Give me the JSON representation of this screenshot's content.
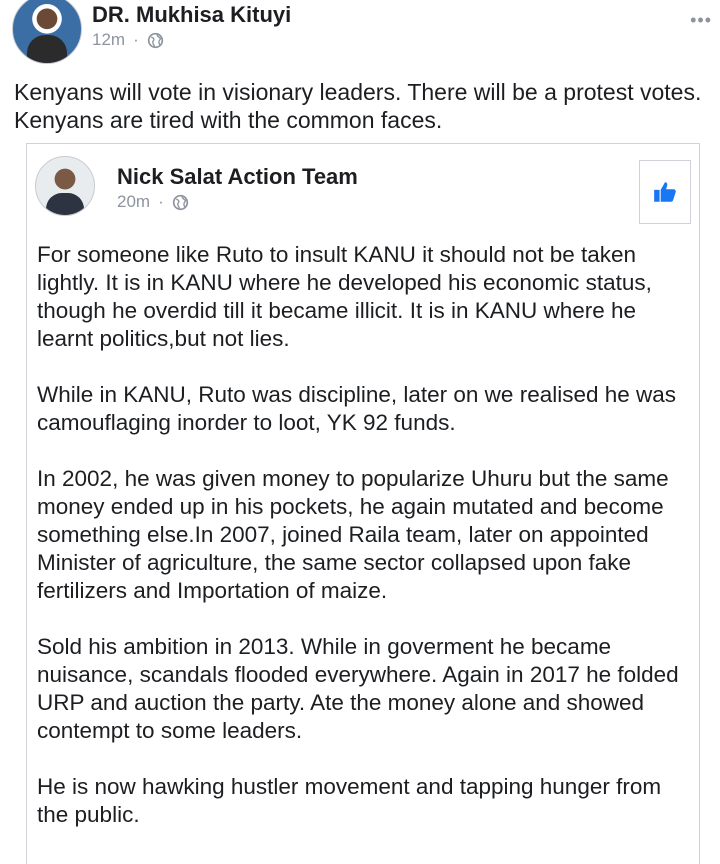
{
  "post": {
    "author": "DR. Mukhisa Kituyi",
    "time": "12m",
    "separator": "·",
    "more": "•••",
    "text": "Kenyans will vote in visionary leaders. There will be a protest votes. Kenyans are tired with the common faces."
  },
  "shared": {
    "author": "Nick Salat Action Team",
    "time": "20m",
    "separator": "·",
    "paragraphs": [
      "For someone like Ruto to insult KANU it should not be taken lightly. It is in KANU where he developed his economic status, though he overdid till it became illicit. It is in KANU where he learnt politics,but not lies.",
      "While in KANU, Ruto was discipline, later on we realised he was camouflaging inorder to loot, YK 92 funds.",
      "In 2002, he was given money to popularize Uhuru but the same money ended up in his pockets, he again mutated and become something else.In 2007, joined Raila team, later on appointed Minister of agriculture, the same sector collapsed upon fake fertilizers and Importation of maize.",
      "Sold his ambition in 2013. While in goverment he became nuisance,  scandals flooded everywhere. Again in 2017 he folded URP and auction the party. Ate the money alone and showed contempt to some leaders.",
      "He is now hawking hustler movement and tapping hunger from the public."
    ]
  },
  "icons": {
    "globe": "globe-icon",
    "more": "more-options-icon",
    "like": "thumbs-up-icon"
  },
  "colors": {
    "text": "#1c1e21",
    "meta": "#8d949e",
    "like_blue": "#1877f2"
  }
}
